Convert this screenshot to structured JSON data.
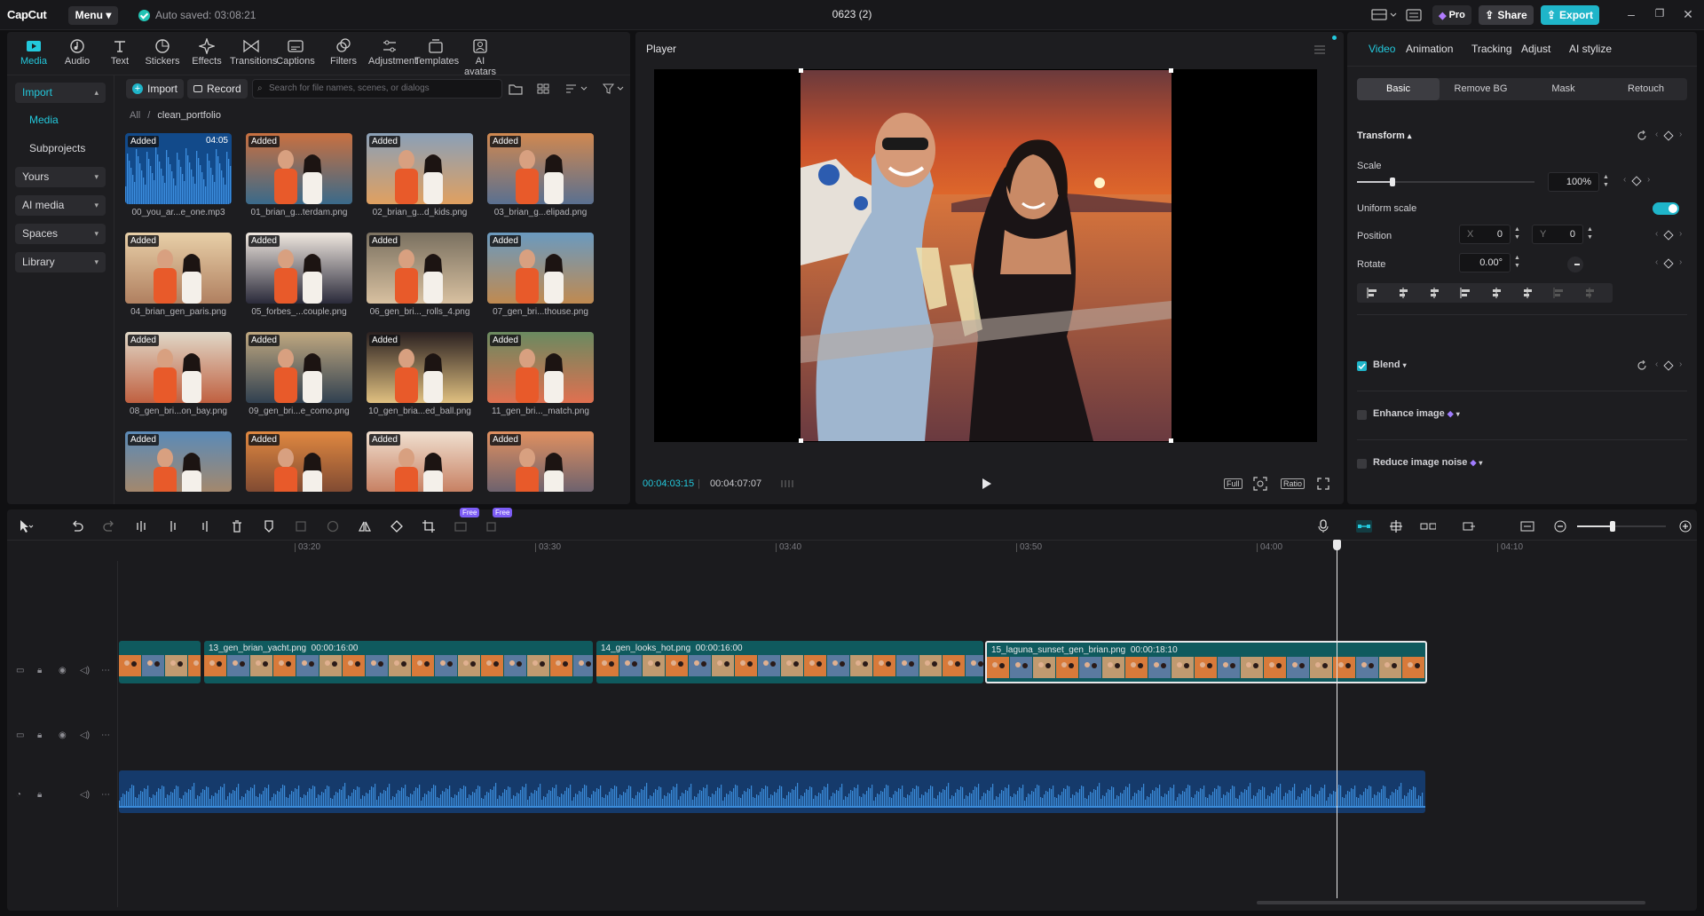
{
  "app": {
    "logo": "CapCut",
    "menu_label": "Menu",
    "autosave": "Auto saved: 03:08:21",
    "project_title": "0623 (2)",
    "pro_label": "Pro",
    "share_label": "Share",
    "export_label": "Export"
  },
  "toolbar": {
    "tabs": [
      {
        "label": "Media",
        "icon": "media-icon",
        "active": true
      },
      {
        "label": "Audio",
        "icon": "audio-icon"
      },
      {
        "label": "Text",
        "icon": "text-icon"
      },
      {
        "label": "Stickers",
        "icon": "stickers-icon"
      },
      {
        "label": "Effects",
        "icon": "effects-icon"
      },
      {
        "label": "Transitions",
        "icon": "transitions-icon"
      },
      {
        "label": "Captions",
        "icon": "captions-icon"
      },
      {
        "label": "Filters",
        "icon": "filters-icon"
      },
      {
        "label": "Adjustment",
        "icon": "adjustment-icon"
      },
      {
        "label": "Templates",
        "icon": "templates-icon"
      },
      {
        "label": "AI avatars",
        "icon": "ai-avatars-icon"
      }
    ]
  },
  "sidebar": {
    "items": [
      {
        "label": "Import",
        "boxed": true,
        "selected": true
      },
      {
        "label": "Media",
        "boxed": false,
        "selected": true
      },
      {
        "label": "Subprojects",
        "boxed": false
      },
      {
        "label": "Yours",
        "boxed": true
      },
      {
        "label": "AI media",
        "boxed": true
      },
      {
        "label": "Spaces",
        "boxed": true
      },
      {
        "label": "Library",
        "boxed": true
      }
    ]
  },
  "media": {
    "import_label": "Import",
    "record_label": "Record",
    "search_placeholder": "Search for file names, scenes, or dialogs",
    "breadcrumb_root": "All",
    "breadcrumb_folder": "clean_portfolio",
    "added_label": "Added",
    "items": [
      {
        "name": "00_you_ar...e_one.mp3",
        "kind": "audio",
        "duration": "04:05"
      },
      {
        "name": "01_brian_g...terdam.png",
        "kind": "image"
      },
      {
        "name": "02_brian_g...d_kids.png",
        "kind": "image"
      },
      {
        "name": "03_brian_g...elipad.png",
        "kind": "image"
      },
      {
        "name": "04_brian_gen_paris.png",
        "kind": "image"
      },
      {
        "name": "05_forbes_...couple.png",
        "kind": "image"
      },
      {
        "name": "06_gen_bri..._rolls_4.png",
        "kind": "image"
      },
      {
        "name": "07_gen_bri...thouse.png",
        "kind": "image"
      },
      {
        "name": "08_gen_bri...on_bay.png",
        "kind": "image"
      },
      {
        "name": "09_gen_bri...e_como.png",
        "kind": "image"
      },
      {
        "name": "10_gen_bria...ed_ball.png",
        "kind": "image"
      },
      {
        "name": "11_gen_bri..._match.png",
        "kind": "image"
      },
      {
        "name": "",
        "kind": "image"
      },
      {
        "name": "",
        "kind": "image"
      },
      {
        "name": "",
        "kind": "image"
      },
      {
        "name": "",
        "kind": "image"
      }
    ]
  },
  "player": {
    "title": "Player",
    "current_time": "00:04:03:15",
    "total_time": "00:04:07:07",
    "full_label": "Full",
    "ratio_label": "Ratio"
  },
  "properties": {
    "tabs": [
      "Video",
      "Animation",
      "Tracking",
      "Adjust",
      "AI stylize"
    ],
    "subtabs": [
      "Basic",
      "Remove BG",
      "Mask",
      "Retouch"
    ],
    "transform_label": "Transform",
    "scale_label": "Scale",
    "scale_value": "100%",
    "scale_fraction": 0.2,
    "uniform_scale_label": "Uniform scale",
    "uniform_scale_on": true,
    "position_label": "Position",
    "pos_x_label": "X",
    "pos_x": "0",
    "pos_y_label": "Y",
    "pos_y": "0",
    "rotate_label": "Rotate",
    "rotate_value": "0.00°",
    "blend_label": "Blend",
    "enhance_label": "Enhance image",
    "noise_label": "Reduce image noise"
  },
  "timeline": {
    "free_label": "Free",
    "ruler": [
      "03:20",
      "03:30",
      "03:40",
      "03:50",
      "04:00",
      "04:10"
    ],
    "clips": [
      {
        "name": "",
        "duration": ""
      },
      {
        "name": "13_gen_brian_yacht.png",
        "duration": "00:00:16:00"
      },
      {
        "name": "14_gen_looks_hot.png",
        "duration": "00:00:16:00"
      },
      {
        "name": "15_laguna_sunset_gen_brian.png",
        "duration": "00:00:18:10"
      }
    ],
    "zoom_fraction": 0.4
  },
  "colors": {
    "accent": "#23c8dc",
    "export": "#1fb5c9",
    "clip": "#0f5a5e",
    "audio": "#1a4a86"
  }
}
